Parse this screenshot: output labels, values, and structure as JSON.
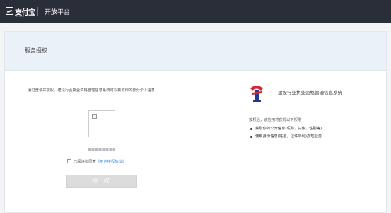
{
  "topbar": {
    "brand_name": "支付宝",
    "brand_sub": "ALIPAY",
    "platform_title": "开放平台"
  },
  "card": {
    "title": "服务授权"
  },
  "left": {
    "description": "通过登录并授权，建设行业执业资格管理信息系统可以获取你的部分个人信息",
    "agree_text": "已阅读和同意",
    "agree_link": "《用户授权协议》",
    "auth_button": "授 权"
  },
  "right": {
    "system_name": "建设行业执业资格管理信息系统",
    "permission_intro": "授权后，该应用将获得以下权限",
    "permissions": [
      "获取你的公开信息(昵称，头像，性别等)",
      "使用身份信息(姓名，证件号码)办理业务"
    ]
  },
  "colors": {
    "topbar": "#2a2e38",
    "header": "#eaf1f8",
    "link": "#3a8ee6",
    "button_disabled": "#dcdcdc",
    "logo_red": "#d8262c",
    "logo_blue": "#1f3b8f"
  },
  "icons": {
    "brand": "alipay-logo-icon",
    "qr": "broken-image-icon",
    "system": "construction-logo-icon"
  }
}
